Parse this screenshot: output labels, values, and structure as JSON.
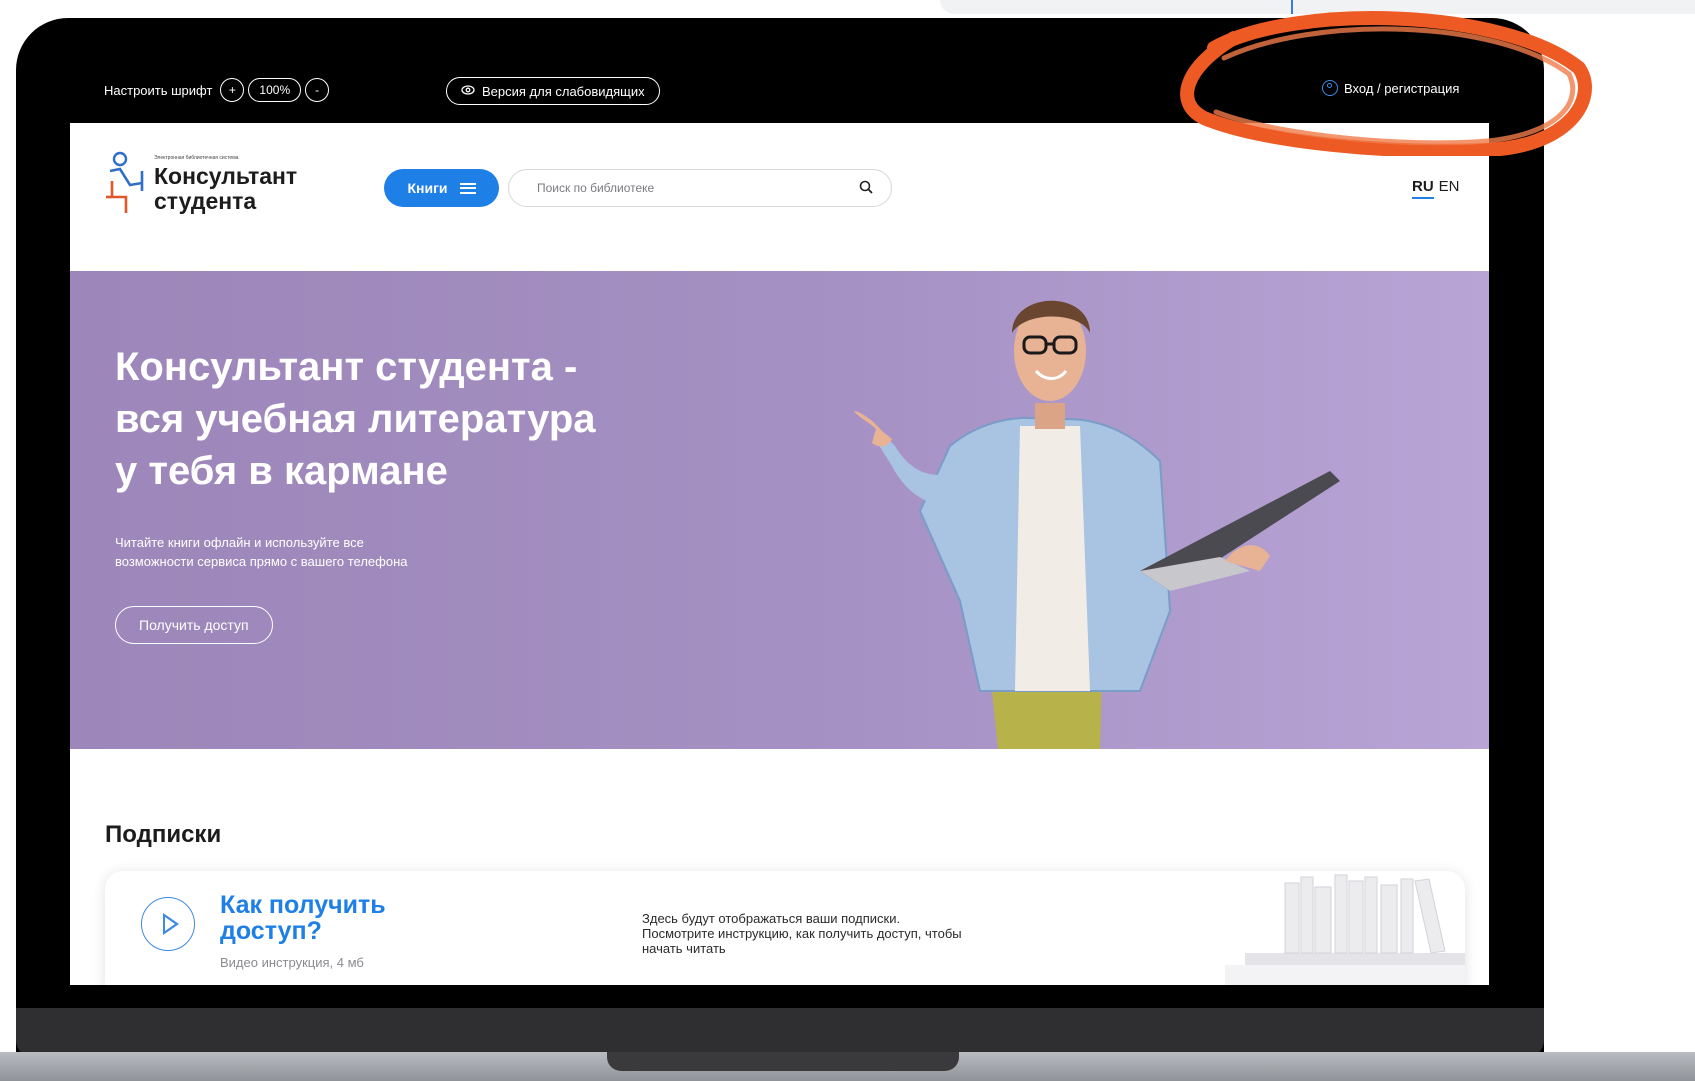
{
  "toolbar": {
    "font_label": "Настроить шрифт",
    "font_increase": "+",
    "font_zoom": "100%",
    "font_decrease": "-",
    "low_vision_label": "Версия для слабовидящих",
    "login_label": "Вход / регистрация"
  },
  "header": {
    "logo_tagline": "Электронная библиотечная система",
    "logo_name_line1": "Консультант",
    "logo_name_line2": "студента",
    "books_button": "Книги",
    "search_placeholder": "Поиск по библиотеке",
    "lang_ru": "RU",
    "lang_en": "EN"
  },
  "hero": {
    "title": "Консультант студента -\nвся учебная литература\nу тебя в кармане",
    "subtitle": "Читайте книги офлайн и используйте все\nвозможности сервиса прямо с вашего телефона",
    "cta": "Получить доступ"
  },
  "subscriptions": {
    "title": "Подписки",
    "access_title": "Как получить\nдоступ?",
    "access_subtitle": "Видео инструкция, 4 мб",
    "info": "Здесь будут отображаться ваши подписки.\nПосмотрите инструкцию, как получить доступ, чтобы\nначать читать"
  },
  "colors": {
    "accent": "#1e7fe6",
    "hero_background": "#a591c3",
    "highlight": "#ee5a24"
  }
}
